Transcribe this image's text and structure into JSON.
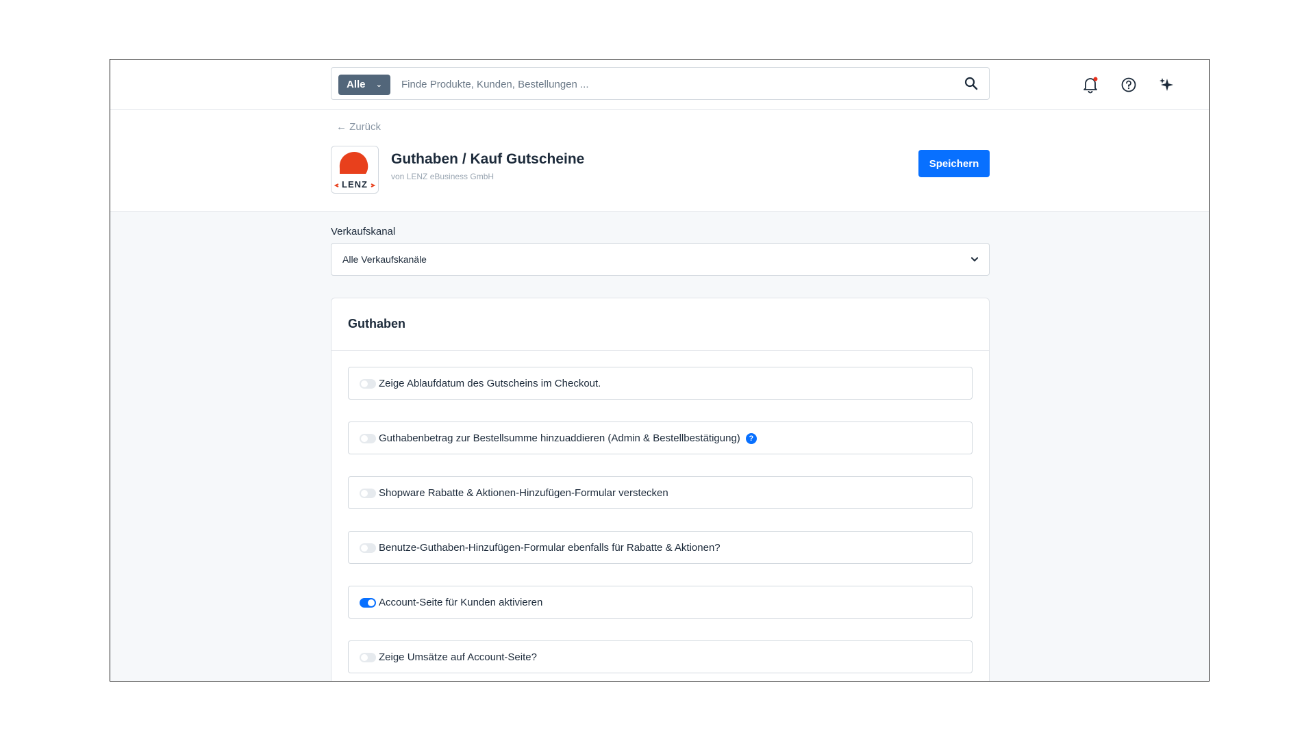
{
  "search": {
    "scope_label": "Alle",
    "placeholder": "Finde Produkte, Kunden, Bestellungen ..."
  },
  "header_icons": [
    "bell-icon",
    "help-icon",
    "sparkle-icon"
  ],
  "page": {
    "back_label": "Zurück",
    "title": "Guthaben / Kauf Gutscheine",
    "subtitle": "von LENZ eBusiness GmbH",
    "save_label": "Speichern",
    "logo_text": "‹LENZ›"
  },
  "sales_channel": {
    "label": "Verkaufskanal",
    "value": "Alle Verkaufskanäle"
  },
  "section": {
    "title": "Guthaben",
    "options": [
      {
        "label": "Zeige Ablaufdatum des Gutscheins im Checkout.",
        "enabled": false
      },
      {
        "label": "Guthabenbetrag zur Bestellsumme hinzuaddieren (Admin & Bestellbestätigung)",
        "enabled": false,
        "info_icon": "?"
      },
      {
        "label": "Shopware Rabatte & Aktionen-Hinzufügen-Formular verstecken",
        "enabled": false
      },
      {
        "label": "Benutze-Guthaben-Hinzufügen-Formular ebenfalls für Rabatte & Aktionen?",
        "enabled": false
      },
      {
        "label": "Account-Seite für Kunden aktivieren",
        "enabled": true
      },
      {
        "label": "Zeige Umsätze auf Account-Seite?",
        "enabled": false
      }
    ]
  },
  "colors": {
    "primary": "#0870ff",
    "dropdown_bg": "#52667a",
    "logo_red": "#e8401c",
    "notification_dot": "#e8301c"
  }
}
